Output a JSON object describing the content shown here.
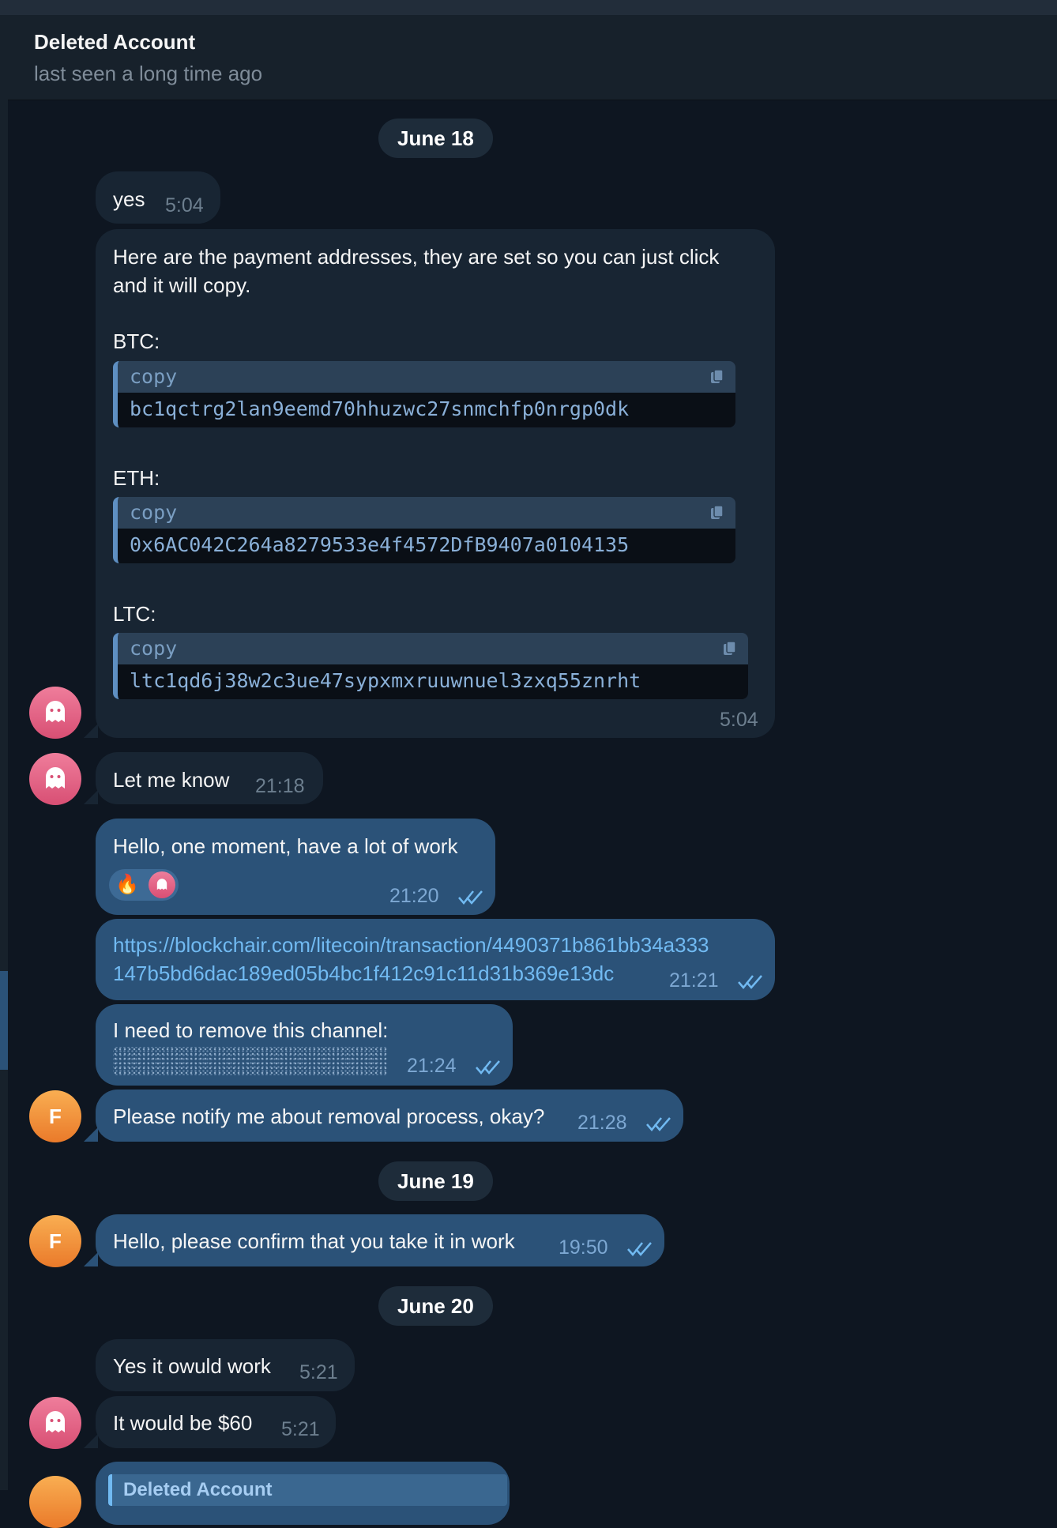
{
  "chat_header": {
    "title": "Deleted Account",
    "subtitle": "last seen a long time ago"
  },
  "dates": [
    "June 18",
    "June 19",
    "June 20"
  ],
  "messages": [
    {
      "text": "yes",
      "time": "5:04"
    },
    {
      "text_line1": "Here are the payment addresses, they are set so you can just click",
      "text_line2": "and it will copy.",
      "addresses": [
        {
          "label": "BTC:",
          "code_label": "copy",
          "value": "bc1qctrg2lan9eemd70hhuzwc27snmchfp0nrgp0dk"
        },
        {
          "label": "ETH:",
          "code_label": "copy",
          "value": "0x6AC042C264a8279533e4f4572DfB9407a0104135"
        },
        {
          "label": "LTC:",
          "code_label": "copy",
          "value": "ltc1qd6j38w2c3ue47sypxmxruuwnuel3zxq55znrht"
        }
      ],
      "time": "5:04"
    },
    {
      "text": "Let me know",
      "time": "21:18"
    },
    {
      "text": "Hello, one moment, have a lot of work",
      "time": "21:20",
      "reaction_emoji": "🔥"
    },
    {
      "link_line1": "https://blockchair.com/litecoin/transaction/4490371b861bb34a333",
      "link_line2": "147b5bd6dac189ed05b4bc1f412c91c11d31b369e13dc",
      "time": "21:21"
    },
    {
      "text": "I need to remove this channel:",
      "time": "21:24"
    },
    {
      "text": "Please notify me about removal process, okay?",
      "time": "21:28"
    },
    {
      "text": "Hello, please confirm that you take it in work",
      "time": "19:50"
    },
    {
      "text": "Yes it owuld work",
      "time": "5:21"
    },
    {
      "text": "It would be $60",
      "time": "5:21"
    },
    {
      "reply_name": "Deleted Account"
    }
  ],
  "avatars": {
    "outgoing_initial": "F"
  },
  "colors": {
    "background": "#0e1621",
    "incoming_bubble": "#182533",
    "outgoing_bubble": "#2b5278",
    "link": "#71baf2",
    "ghost_avatar": "#e5627f",
    "f_avatar": "#f28f3b"
  },
  "icons": [
    "ghost-icon",
    "copy-icon",
    "double-check-icon",
    "fire-emoji"
  ]
}
